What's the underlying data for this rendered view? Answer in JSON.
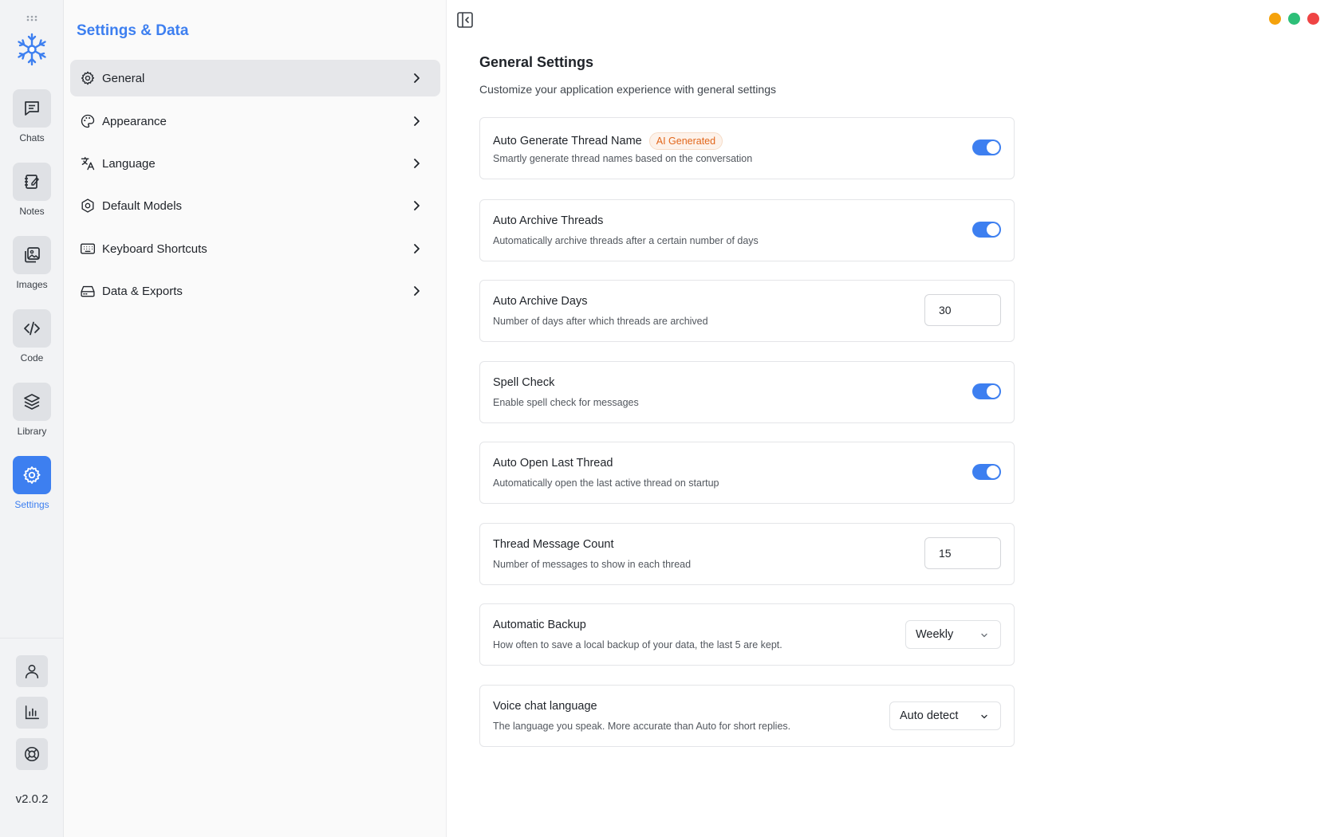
{
  "rail": {
    "items": [
      {
        "label": "Chats",
        "icon": "chat-icon"
      },
      {
        "label": "Notes",
        "icon": "notes-icon"
      },
      {
        "label": "Images",
        "icon": "images-icon"
      },
      {
        "label": "Code",
        "icon": "code-icon"
      },
      {
        "label": "Library",
        "icon": "library-icon"
      },
      {
        "label": "Settings",
        "icon": "settings-icon"
      }
    ],
    "active": "Settings",
    "bottom_icons": [
      "user-icon",
      "bar-chart-icon",
      "lifebuoy-icon"
    ],
    "version": "v2.0.2"
  },
  "nav": {
    "title": "Settings & Data",
    "items": [
      {
        "label": "General",
        "icon": "gear-icon"
      },
      {
        "label": "Appearance",
        "icon": "palette-icon"
      },
      {
        "label": "Language",
        "icon": "translate-icon"
      },
      {
        "label": "Default Models",
        "icon": "hexagon-icon"
      },
      {
        "label": "Keyboard Shortcuts",
        "icon": "keyboard-icon"
      },
      {
        "label": "Data & Exports",
        "icon": "drive-icon"
      }
    ],
    "active": "General"
  },
  "window_controls": {
    "colors": [
      "#f5a20b",
      "#2dbf78",
      "#ef4444"
    ]
  },
  "main": {
    "title": "General Settings",
    "subtitle": "Customize your application experience with general settings",
    "settings": [
      {
        "title": "Auto Generate Thread Name",
        "badge": "AI Generated",
        "description": "Smartly generate thread names based on the conversation",
        "control": "toggle",
        "value": true
      },
      {
        "title": "Auto Archive Threads",
        "description": "Automatically archive threads after a certain number of days",
        "control": "toggle",
        "value": true
      },
      {
        "title": "Auto Archive Days",
        "description": "Number of days after which threads are archived",
        "control": "number",
        "value": "30"
      },
      {
        "title": "Spell Check",
        "description": "Enable spell check for messages",
        "control": "toggle",
        "value": true
      },
      {
        "title": "Auto Open Last Thread",
        "description": "Automatically open the last active thread on startup",
        "control": "toggle",
        "value": true
      },
      {
        "title": "Thread Message Count",
        "description": "Number of messages to show in each thread",
        "control": "number",
        "value": "15"
      },
      {
        "title": "Automatic Backup",
        "description": "How often to save a local backup of your data, the last 5 are kept.",
        "control": "select",
        "value": "Weekly"
      },
      {
        "title": "Voice chat language",
        "description": "The language you speak. More accurate than Auto for short replies.",
        "control": "select",
        "value": "Auto detect"
      }
    ]
  },
  "colors": {
    "accent": "#3d7ff0",
    "badge_text": "#e2661b"
  }
}
